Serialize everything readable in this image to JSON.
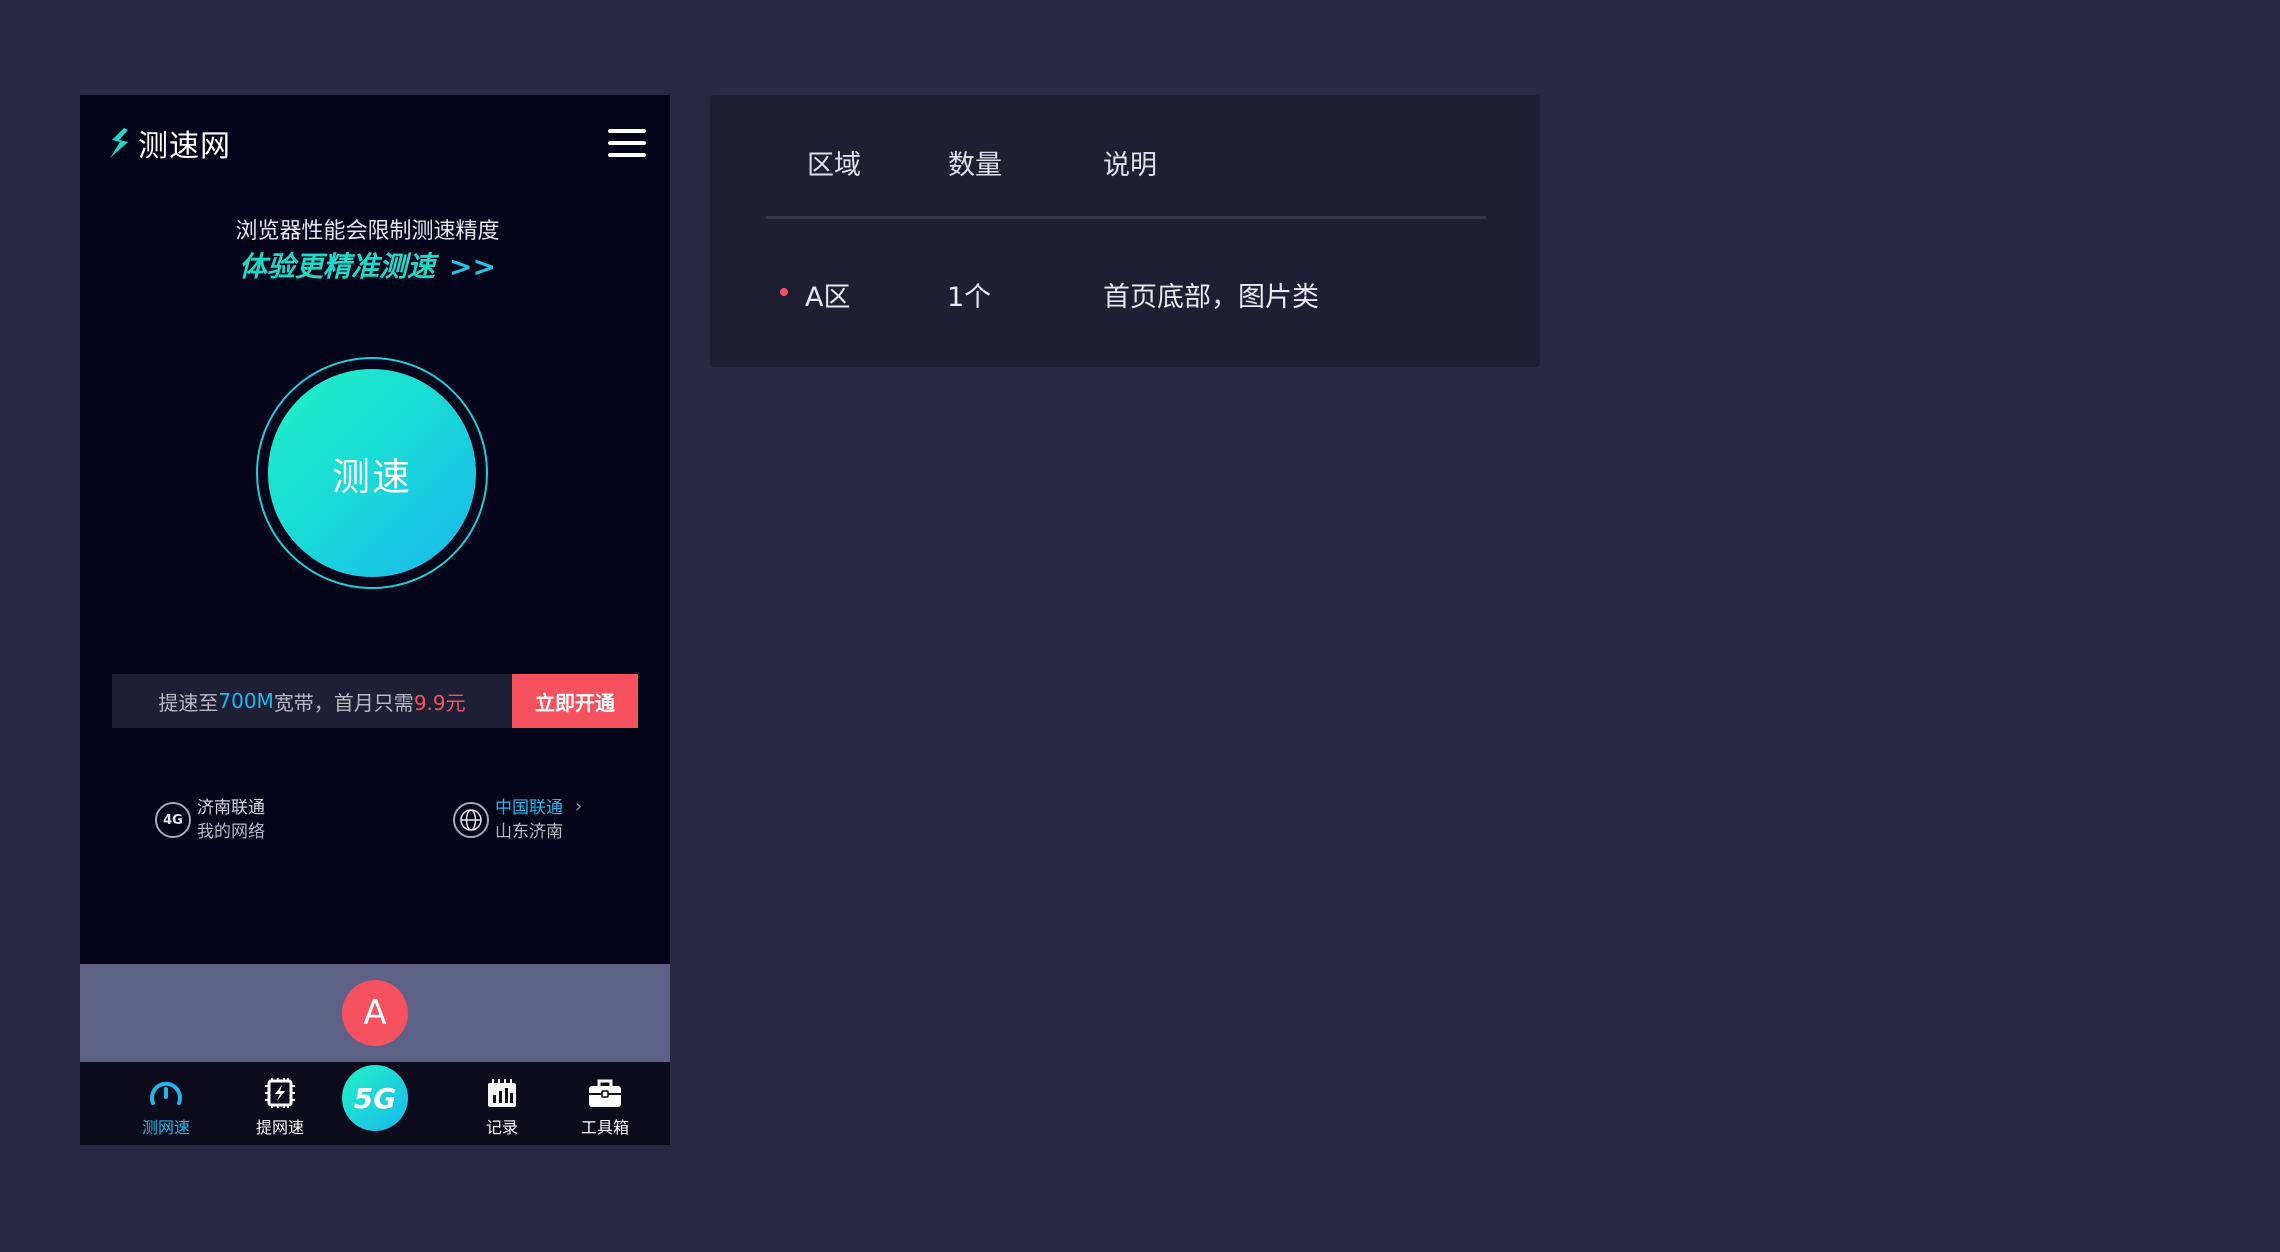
{
  "header": {
    "logo_text": "测速网"
  },
  "promo": {
    "line1": "浏览器性能会限制测速精度",
    "line2": "体验更精准测速",
    "line2_arrows": ">>"
  },
  "speed_test": {
    "button_label": "测速"
  },
  "upgrade": {
    "text_prefix": "提速至",
    "speed": "700M",
    "text_middle": "宽带，首月只需",
    "price": "9.9元",
    "button_label": "立即开通"
  },
  "network": {
    "left_badge": "4G",
    "left_line1": "济南联通",
    "left_line2": "我的网络",
    "right_line1": "中国联通",
    "right_line2": "山东济南"
  },
  "ad_slot": {
    "badge": "A"
  },
  "tabbar": {
    "tabs": [
      {
        "label": "测网速",
        "icon": "speedometer-icon",
        "active": true
      },
      {
        "label": "提网速",
        "icon": "chip-bolt-icon",
        "active": false
      },
      {
        "label": "5G",
        "icon": "5g-icon",
        "active": false
      },
      {
        "label": "记录",
        "icon": "record-chart-icon",
        "active": false
      },
      {
        "label": "工具箱",
        "icon": "toolbox-icon",
        "active": false
      }
    ]
  },
  "info_panel": {
    "headers": [
      "区域",
      "数量",
      "说明"
    ],
    "rows": [
      {
        "area": "A区",
        "count": "1个",
        "desc": "首页底部，图片类"
      }
    ]
  },
  "colors": {
    "accent_cyan": "#1FD9C6",
    "accent_blue": "#1FB8E8",
    "accent_red": "#F5515F",
    "background": "#292941",
    "phone_bg": "#03031A",
    "ad_slot_bg": "#5D6185"
  }
}
